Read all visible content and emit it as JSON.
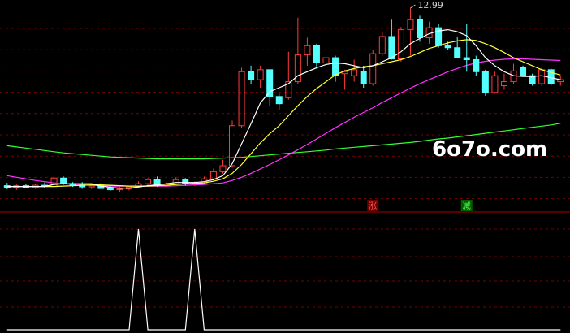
{
  "chart_data": [
    {
      "type": "candlestick",
      "max_label": "12.99",
      "watermark": "6o7o.com",
      "marks": [
        {
          "index": 39,
          "text": "涨",
          "color": "#ff6060",
          "box": "#700000"
        },
        {
          "index": 49,
          "text": "减",
          "color": "#60ff60",
          "box": "#006000"
        }
      ],
      "colors": {
        "up": "#ff3b3b",
        "down": "#54ffff",
        "ma5": "#ffffff",
        "ma10": "#ffff33",
        "ma20": "#ff33ff",
        "ma60": "#33ff33",
        "grid": "#7a0000"
      },
      "candles": [
        [
          8.55,
          8.62,
          8.46,
          8.51
        ],
        [
          8.51,
          8.58,
          8.45,
          8.55
        ],
        [
          8.55,
          8.6,
          8.48,
          8.5
        ],
        [
          8.5,
          8.6,
          8.47,
          8.56
        ],
        [
          8.56,
          8.63,
          8.5,
          8.53
        ],
        [
          8.53,
          8.8,
          8.51,
          8.74
        ],
        [
          8.74,
          8.78,
          8.57,
          8.6
        ],
        [
          8.6,
          8.64,
          8.52,
          8.57
        ],
        [
          8.57,
          8.64,
          8.47,
          8.52
        ],
        [
          8.52,
          8.59,
          8.47,
          8.55
        ],
        [
          8.55,
          8.62,
          8.46,
          8.48
        ],
        [
          8.48,
          8.55,
          8.42,
          8.45
        ],
        [
          8.45,
          8.52,
          8.4,
          8.47
        ],
        [
          8.47,
          8.55,
          8.43,
          8.52
        ],
        [
          8.52,
          8.66,
          8.48,
          8.6
        ],
        [
          8.6,
          8.74,
          8.55,
          8.7
        ],
        [
          8.7,
          8.78,
          8.52,
          8.56
        ],
        [
          8.56,
          8.63,
          8.52,
          8.59
        ],
        [
          8.59,
          8.76,
          8.54,
          8.7
        ],
        [
          8.7,
          8.74,
          8.55,
          8.6
        ],
        [
          8.6,
          8.66,
          8.54,
          8.62
        ],
        [
          8.62,
          8.78,
          8.6,
          8.72
        ],
        [
          8.72,
          8.98,
          8.68,
          8.9
        ],
        [
          8.9,
          9.2,
          8.85,
          9.05
        ],
        [
          9.05,
          10.18,
          9.0,
          10.05
        ],
        [
          10.05,
          11.5,
          10.0,
          11.4
        ],
        [
          11.4,
          11.55,
          11.1,
          11.2
        ],
        [
          11.2,
          11.55,
          11.0,
          11.45
        ],
        [
          11.45,
          11.25,
          10.55,
          10.78
        ],
        [
          10.78,
          10.85,
          10.45,
          10.6
        ],
        [
          10.75,
          11.9,
          10.7,
          11.15
        ],
        [
          11.15,
          12.75,
          11.1,
          11.82
        ],
        [
          11.82,
          12.25,
          11.55,
          12.05
        ],
        [
          12.05,
          12.1,
          11.48,
          11.62
        ],
        [
          11.62,
          12.4,
          11.45,
          11.75
        ],
        [
          11.75,
          11.8,
          11.15,
          11.3
        ],
        [
          11.35,
          11.45,
          10.95,
          11.4
        ],
        [
          11.3,
          11.7,
          11.15,
          11.45
        ],
        [
          11.4,
          11.55,
          11.0,
          11.1
        ],
        [
          11.1,
          11.95,
          11.05,
          11.85
        ],
        [
          11.85,
          12.4,
          11.8,
          12.28
        ],
        [
          12.28,
          12.7,
          11.7,
          11.72
        ],
        [
          11.72,
          12.52,
          11.65,
          12.45
        ],
        [
          12.45,
          12.99,
          11.8,
          12.7
        ],
        [
          12.7,
          12.8,
          12.15,
          12.25
        ],
        [
          12.25,
          12.65,
          12.1,
          12.5
        ],
        [
          12.5,
          12.6,
          12.0,
          12.05
        ],
        [
          12.05,
          12.15,
          11.95,
          12.0
        ],
        [
          12.0,
          12.28,
          11.75,
          11.75
        ],
        [
          11.75,
          12.6,
          11.4,
          11.7
        ],
        [
          11.7,
          11.8,
          11.3,
          11.4
        ],
        [
          11.4,
          11.45,
          10.8,
          10.88
        ],
        [
          10.88,
          11.4,
          10.85,
          11.3
        ],
        [
          11.05,
          11.35,
          10.95,
          11.15
        ],
        [
          11.15,
          11.6,
          11.1,
          11.42
        ],
        [
          11.5,
          11.55,
          11.28,
          11.3
        ],
        [
          11.3,
          11.35,
          11.05,
          11.1
        ],
        [
          11.1,
          11.5,
          11.05,
          11.45
        ],
        [
          11.45,
          11.48,
          11.05,
          11.1
        ],
        [
          11.15,
          11.3,
          11.05,
          11.2
        ]
      ],
      "ma5": [
        8.53,
        8.53,
        8.53,
        8.53,
        8.53,
        8.58,
        8.6,
        8.6,
        8.6,
        8.6,
        8.54,
        8.51,
        8.49,
        8.49,
        8.52,
        8.55,
        8.57,
        8.6,
        8.63,
        8.63,
        8.63,
        8.65,
        8.7,
        8.8,
        9.1,
        9.6,
        10.1,
        10.62,
        10.9,
        11.0,
        11.1,
        11.3,
        11.4,
        11.5,
        11.58,
        11.62,
        11.6,
        11.55,
        11.5,
        11.55,
        11.65,
        11.75,
        11.9,
        12.1,
        12.23,
        12.35,
        12.42,
        12.45,
        12.4,
        12.3,
        12.05,
        11.75,
        11.55,
        11.4,
        11.3,
        11.28,
        11.28,
        11.3,
        11.25,
        11.2
      ],
      "ma10": [
        8.53,
        8.53,
        8.53,
        8.53,
        8.53,
        8.53,
        8.54,
        8.55,
        8.56,
        8.57,
        8.57,
        8.56,
        8.55,
        8.54,
        8.54,
        8.54,
        8.55,
        8.56,
        8.58,
        8.6,
        8.61,
        8.62,
        8.66,
        8.72,
        8.86,
        9.08,
        9.35,
        9.62,
        9.85,
        10.05,
        10.3,
        10.55,
        10.78,
        10.98,
        11.15,
        11.32,
        11.42,
        11.48,
        11.52,
        11.55,
        11.6,
        11.65,
        11.7,
        11.78,
        11.88,
        11.98,
        12.05,
        12.12,
        12.17,
        12.2,
        12.18,
        12.1,
        12.0,
        11.88,
        11.75,
        11.65,
        11.55,
        11.45,
        11.38,
        11.32
      ],
      "ma20": [
        8.8,
        8.76,
        8.72,
        8.68,
        8.65,
        8.62,
        8.6,
        8.58,
        8.57,
        8.56,
        8.55,
        8.54,
        8.54,
        8.54,
        8.54,
        8.54,
        8.54,
        8.54,
        8.55,
        8.56,
        8.57,
        8.58,
        8.6,
        8.62,
        8.68,
        8.76,
        8.86,
        8.97,
        9.08,
        9.2,
        9.32,
        9.45,
        9.58,
        9.72,
        9.86,
        10.0,
        10.13,
        10.26,
        10.38,
        10.5,
        10.63,
        10.75,
        10.87,
        10.99,
        11.1,
        11.2,
        11.3,
        11.4,
        11.48,
        11.56,
        11.62,
        11.66,
        11.69,
        11.71,
        11.72,
        11.72,
        11.71,
        11.7,
        11.69,
        11.68
      ],
      "ma60": [
        9.55,
        9.52,
        9.49,
        9.46,
        9.43,
        9.4,
        9.37,
        9.35,
        9.33,
        9.31,
        9.29,
        9.27,
        9.26,
        9.25,
        9.24,
        9.23,
        9.22,
        9.22,
        9.22,
        9.22,
        9.22,
        9.22,
        9.23,
        9.24,
        9.25,
        9.26,
        9.28,
        9.3,
        9.32,
        9.34,
        9.36,
        9.38,
        9.4,
        9.42,
        9.44,
        9.47,
        9.49,
        9.51,
        9.53,
        9.55,
        9.57,
        9.59,
        9.61,
        9.63,
        9.66,
        9.69,
        9.72,
        9.74,
        9.77,
        9.8,
        9.83,
        9.86,
        9.89,
        9.92,
        9.95,
        9.98,
        10.01,
        10.04,
        10.07,
        10.11
      ]
    },
    {
      "type": "line",
      "series": [
        {
          "values": [
            0,
            0,
            0,
            0,
            0,
            0,
            0,
            0,
            0,
            0,
            0,
            0,
            0,
            0,
            1,
            0,
            0,
            0,
            0,
            0,
            1,
            0,
            0,
            0,
            0,
            0,
            0,
            0,
            0,
            0,
            0,
            0,
            0,
            0,
            0,
            0,
            0,
            0,
            0,
            0,
            0,
            0,
            0,
            0,
            0,
            0,
            0,
            0,
            0,
            0,
            0,
            0,
            0,
            0,
            0,
            0,
            0,
            0,
            0,
            0
          ]
        }
      ],
      "color": "#ffffff"
    }
  ]
}
